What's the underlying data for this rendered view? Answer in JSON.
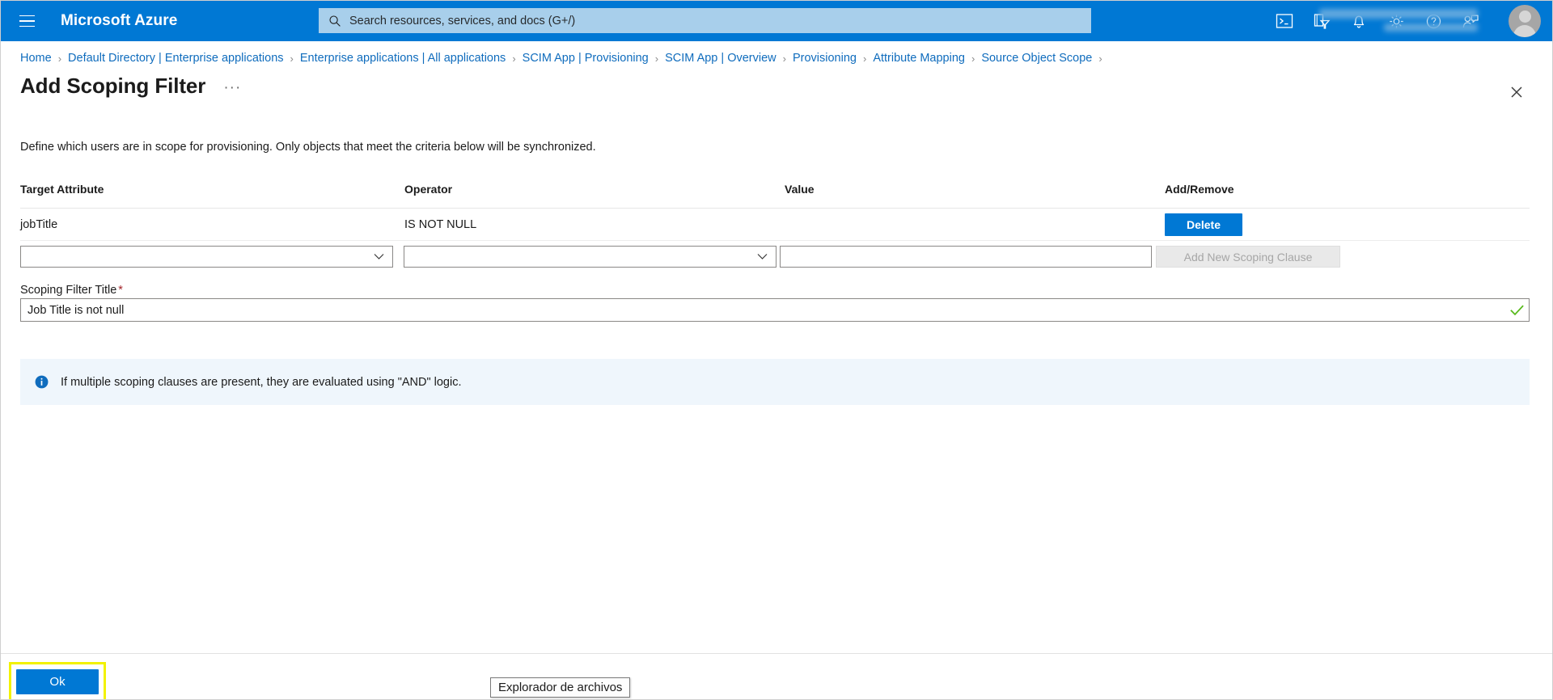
{
  "topbar": {
    "brand": "Microsoft Azure",
    "menu_label": "hamburger-menu",
    "search_placeholder": "Search resources, services, and docs (G+/)",
    "icons": [
      {
        "name": "cloud-shell-icon",
        "title": "Cloud Shell"
      },
      {
        "name": "directories-filter-icon",
        "title": "Directories + subscriptions"
      },
      {
        "name": "notifications-bell-icon",
        "title": "Notifications"
      },
      {
        "name": "settings-gear-icon",
        "title": "Settings"
      },
      {
        "name": "help-question-icon",
        "title": "Help"
      },
      {
        "name": "feedback-person-icon",
        "title": "Feedback"
      }
    ],
    "account_name": "",
    "account_directory": ""
  },
  "breadcrumb": {
    "separator": "›",
    "items": [
      "Home",
      "Default Directory | Enterprise applications",
      "Enterprise applications | All applications",
      "SCIM App | Provisioning",
      "SCIM App | Overview",
      "Provisioning",
      "Attribute Mapping",
      "Source Object Scope"
    ]
  },
  "page": {
    "title": "Add Scoping Filter",
    "more_label": "···",
    "close_label": "Close",
    "description": "Define which users are in scope for provisioning. Only objects that meet the criteria below will be synchronized."
  },
  "table": {
    "columns": [
      "Target Attribute",
      "Operator",
      "Value",
      "Add/Remove"
    ],
    "rows": [
      {
        "target_attribute": "jobTitle",
        "operator": "IS NOT NULL",
        "value": "",
        "action_label": "Delete"
      }
    ],
    "new_row": {
      "attribute_value": "",
      "attribute_placeholder": "",
      "operator_value": "",
      "operator_placeholder": "",
      "value_value": "",
      "value_placeholder": "",
      "add_button_label": "Add New Scoping Clause"
    }
  },
  "scoping_filter_title": {
    "label": "Scoping Filter Title",
    "required_marker": "*",
    "value": "Job Title is not null",
    "placeholder": "",
    "valid_icon": "check-icon"
  },
  "info_banner": {
    "icon": "info-icon",
    "text": "If multiple scoping clauses are present, they are evaluated using \"AND\" logic."
  },
  "footer": {
    "ok_label": "Ok"
  },
  "taskbar": {
    "tooltip": "Explorador de archivos"
  },
  "colors": {
    "azure_blue": "#0078d4",
    "link_blue": "#0f6cbd",
    "info_bg": "#eff6fc",
    "required_red": "#a4262c",
    "valid_green": "#5aba1e",
    "highlight_yellow": "#f2f200",
    "search_bg": "#a8cfeb"
  }
}
